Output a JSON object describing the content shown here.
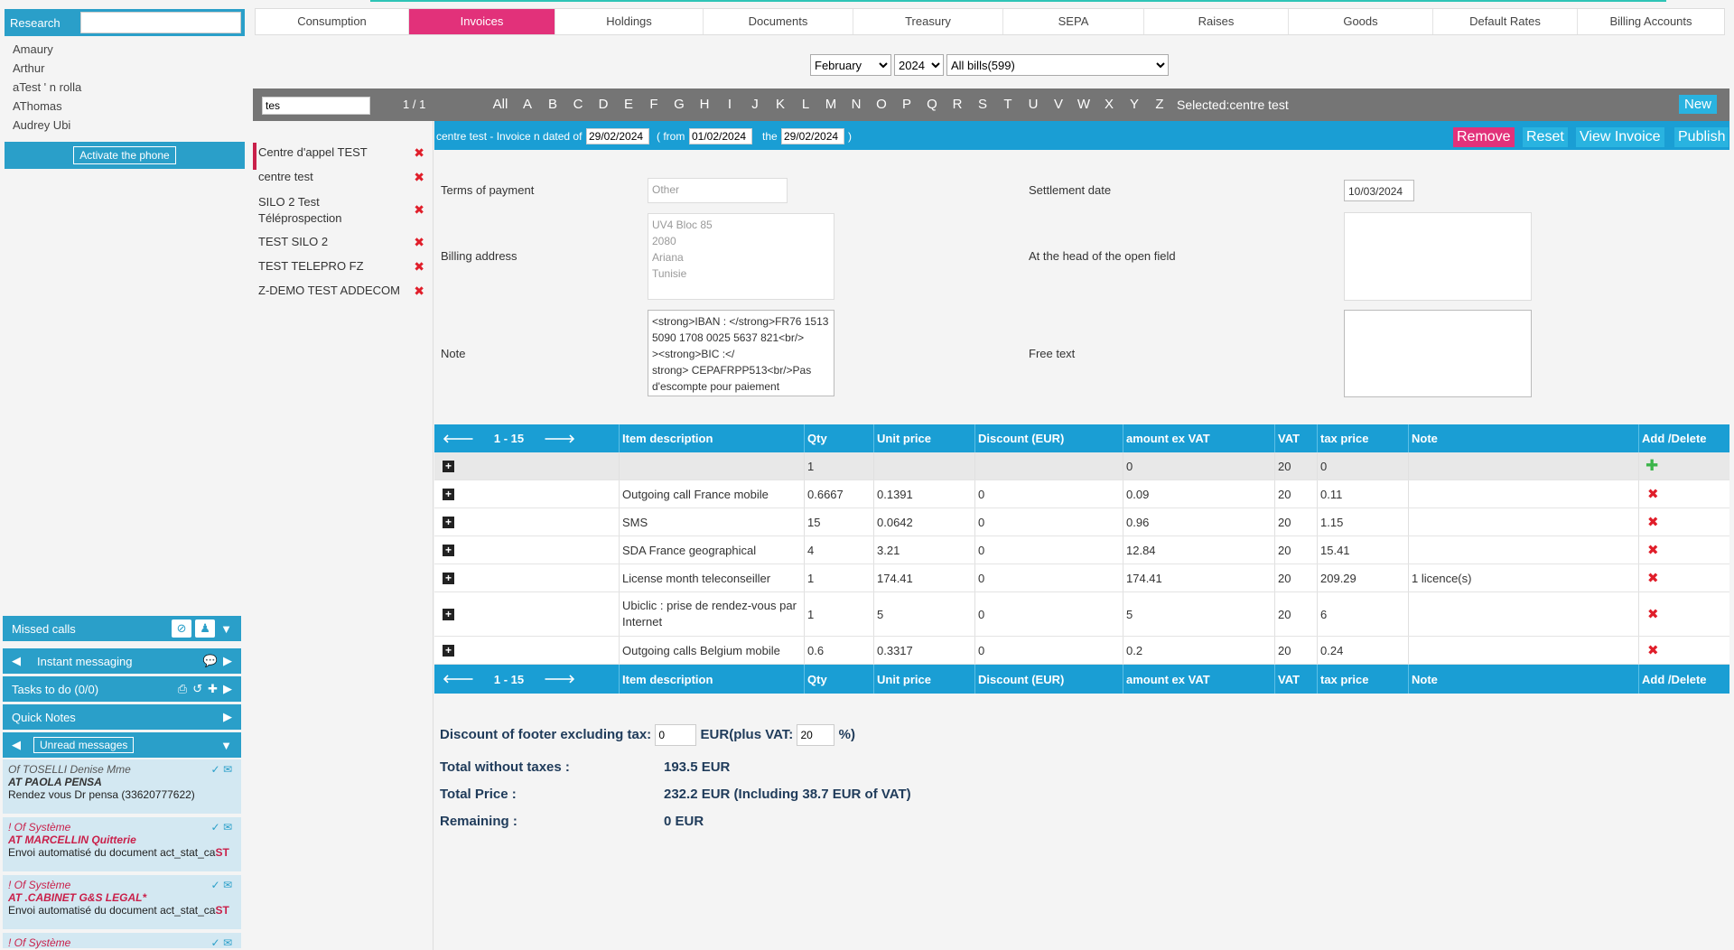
{
  "sidebar": {
    "search_label": "Research",
    "contacts": [
      "Amaury",
      "Arthur",
      "aTest ' n rolla",
      "AThomas",
      "Audrey Ubi"
    ],
    "activate_label": "Activate the phone",
    "missed_calls": "Missed calls",
    "instant_messaging": "Instant messaging",
    "tasks": "Tasks to do (0/0)",
    "quick_notes": "Quick Notes",
    "unread": "Unread messages",
    "messages": [
      {
        "from": "Of TOSELLI Denise Mme",
        "to": "AT PAOLA PENSA",
        "body": "Rendez vous Dr pensa (33620777622)",
        "system": false,
        "st": ""
      },
      {
        "from": "! Of Système",
        "to": "AT MARCELLIN Quitterie",
        "body": "Envoi automatisé du document act_stat_ca",
        "system": true,
        "st": "ST"
      },
      {
        "from": "! Of Système",
        "to": "AT .CABINET G&S LEGAL*",
        "body": "Envoi automatisé du document act_stat_ca",
        "system": true,
        "st": "ST"
      },
      {
        "from": "! Of Système",
        "to": "",
        "body": "",
        "system": true,
        "st": ""
      }
    ]
  },
  "tabs": [
    "Consumption",
    "Invoices",
    "Holdings",
    "Documents",
    "Treasury",
    "SEPA",
    "Raises",
    "Goods",
    "Default Rates",
    "Billing Accounts"
  ],
  "active_tab": "Invoices",
  "filters": {
    "month": "February",
    "year": "2024",
    "bills": "All bills(599)"
  },
  "alpha": {
    "search_value": "tes",
    "page": "1 / 1",
    "letters": [
      "All",
      "A",
      "B",
      "C",
      "D",
      "E",
      "F",
      "G",
      "H",
      "I",
      "J",
      "K",
      "L",
      "M",
      "N",
      "O",
      "P",
      "Q",
      "R",
      "S",
      "T",
      "U",
      "V",
      "W",
      "X",
      "Y",
      "Z"
    ],
    "selected": "Selected:centre test",
    "new_label": "New"
  },
  "clients": [
    "Centre d'appel TEST",
    "centre test",
    "SILO 2 Test Téléprospection",
    "TEST SILO 2",
    "TEST TELEPRO FZ",
    "Z-DEMO TEST ADDECOM"
  ],
  "invoice_header": {
    "title": "centre test - Invoice n dated of",
    "date": "29/02/2024",
    "from_label": "( from",
    "from": "01/02/2024",
    "the_label": "the",
    "to": "29/02/2024",
    "close": ")",
    "remove": "Remove",
    "reset": "Reset",
    "view": "View Invoice",
    "publish": "Publish"
  },
  "form": {
    "terms_label": "Terms of payment",
    "terms_value": "Other",
    "settlement_label": "Settlement date",
    "settlement_value": "10/03/2024",
    "billing_label": "Billing address",
    "billing_lines": [
      "UV4 Bloc 85",
      "2080",
      "Ariana",
      "Tunisie"
    ],
    "head_label": "At the head of the open field",
    "note_label": "Note",
    "note_lines": [
      "<strong>IBAN : </strong>FR76 1513",
      "5090 1708 0025 5637 821<br/>",
      "><strong>BIC :</",
      "strong> CEPAFRPP513<br/>Pas",
      "d'escompte pour paiement"
    ],
    "free_label": "Free text"
  },
  "table": {
    "range": "1 - 15",
    "columns": [
      "Item description",
      "Qty",
      "Unit price",
      "Discount (EUR)",
      "amount ex VAT",
      "VAT",
      "tax price",
      "Note",
      "Add /Delete"
    ],
    "new_row": {
      "desc": "",
      "qty": "1",
      "unit": "",
      "disc": "",
      "amount": "0",
      "vat": "20",
      "tax": "0",
      "note": ""
    },
    "rows": [
      {
        "desc": "Outgoing call France mobile",
        "qty": "0.6667",
        "unit": "0.1391",
        "disc": "0",
        "amount": "0.09",
        "vat": "20",
        "tax": "0.11",
        "note": ""
      },
      {
        "desc": "SMS",
        "qty": "15",
        "unit": "0.0642",
        "disc": "0",
        "amount": "0.96",
        "vat": "20",
        "tax": "1.15",
        "note": ""
      },
      {
        "desc": "SDA France geographical",
        "qty": "4",
        "unit": "3.21",
        "disc": "0",
        "amount": "12.84",
        "vat": "20",
        "tax": "15.41",
        "note": ""
      },
      {
        "desc": "License month teleconseiller",
        "qty": "1",
        "unit": "174.41",
        "disc": "0",
        "amount": "174.41",
        "vat": "20",
        "tax": "209.29",
        "note": "1 licence(s)"
      },
      {
        "desc": "Ubiclic : prise de rendez-vous par Internet",
        "qty": "1",
        "unit": "5",
        "disc": "0",
        "amount": "5",
        "vat": "20",
        "tax": "6",
        "note": ""
      },
      {
        "desc": "Outgoing calls Belgium mobile",
        "qty": "0.6",
        "unit": "0.3317",
        "disc": "0",
        "amount": "0.2",
        "vat": "20",
        "tax": "0.24",
        "note": ""
      }
    ]
  },
  "totals": {
    "discount_label": "Discount of footer excluding tax:",
    "discount_value": "0",
    "eur_label": "EUR(plus VAT:",
    "vat_value": "20",
    "pct": "%)",
    "without_label": "Total without taxes :",
    "without_value": "193.5 EUR",
    "price_label": "Total Price :",
    "price_value": "232.2 EUR (Including 38.7 EUR of VAT)",
    "remaining_label": "Remaining :",
    "remaining_value": "0 EUR"
  }
}
